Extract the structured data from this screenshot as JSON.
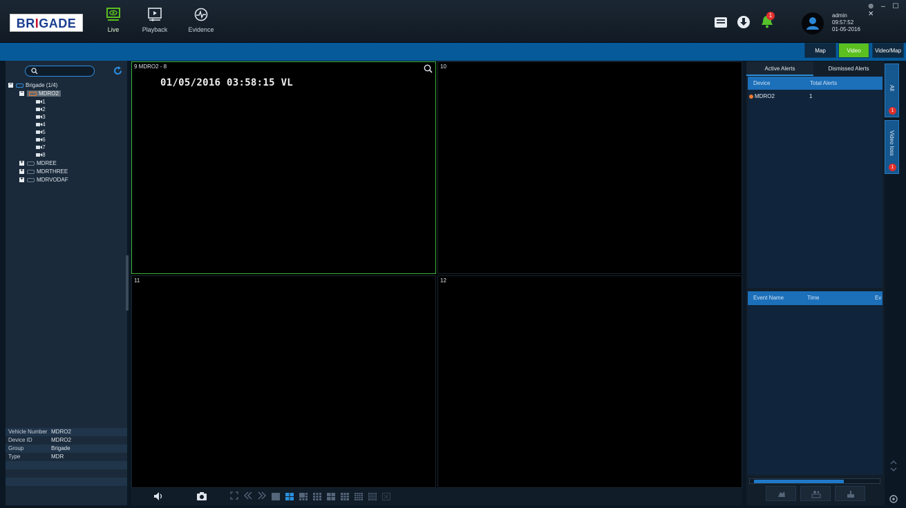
{
  "topbar": {
    "logo_part1": "BR",
    "logo_part2": "GADE",
    "nav": [
      {
        "label": "Live",
        "icon": "monitor-eye-icon",
        "active": true
      },
      {
        "label": "Playback",
        "icon": "playback-icon",
        "active": false
      },
      {
        "label": "Evidence",
        "icon": "evidence-icon",
        "active": false
      }
    ],
    "alert_count": "1",
    "user": {
      "name": "admin",
      "time": "09:57:52",
      "date": "01-05-2016"
    },
    "window_controls": "⊕ – ☐ ✕"
  },
  "view_buttons": {
    "map": "Map",
    "video": "Video",
    "video_map": "Video/Map"
  },
  "accent_color": "#5bbf1f",
  "tree": {
    "root": "Brigade (1/4)",
    "devices": [
      {
        "name": "MDRO2",
        "expanded": true,
        "cameras": [
          "1",
          "2",
          "3",
          "4",
          "5",
          "6",
          "7",
          "8"
        ]
      },
      {
        "name": "MDREE",
        "expanded": false
      },
      {
        "name": "MDRTHREE",
        "expanded": false
      },
      {
        "name": "MDRVODAF",
        "expanded": false
      }
    ]
  },
  "device_info": [
    {
      "key": "Vehicle Number",
      "value": "MDRO2"
    },
    {
      "key": "Device ID",
      "value": "MDRO2"
    },
    {
      "key": "Group",
      "value": "Brigade"
    },
    {
      "key": "Type",
      "value": "MDR"
    }
  ],
  "tiles": [
    {
      "name": "9 MDRO2 - 8",
      "osd": "01/05/2016 03:58:15 VL"
    },
    {
      "name": "10"
    },
    {
      "name": "11"
    },
    {
      "name": "12"
    }
  ],
  "alerts": {
    "tabs": {
      "active": "Active Alerts",
      "dismissed": "Dismissed Alerts"
    },
    "columns": {
      "device": "Device",
      "total": "Total Alerts"
    },
    "rows": [
      {
        "device": "MDRO2",
        "total": "1"
      }
    ],
    "event_columns": {
      "name": "Event Name",
      "time": "Time",
      "ev": "Ev"
    }
  },
  "side_tabs": [
    {
      "label": "All",
      "badge": "1"
    },
    {
      "label": "Video loss",
      "badge": "1"
    }
  ]
}
